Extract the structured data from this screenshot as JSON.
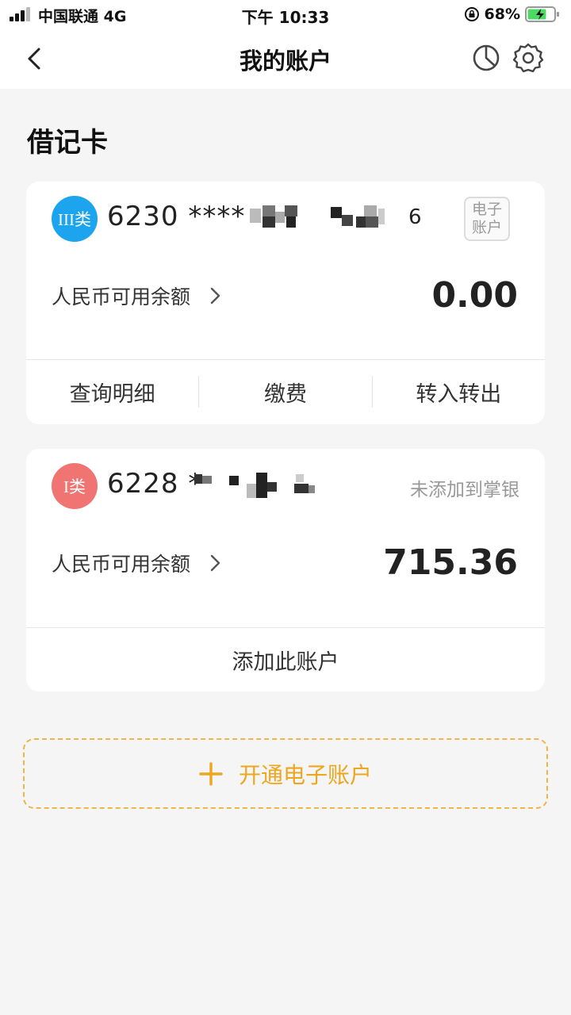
{
  "status_bar": {
    "carrier": "中国联通  4G",
    "time": "下午 10:33",
    "battery": "68%"
  },
  "nav": {
    "title": "我的账户",
    "icons": [
      "back-icon",
      "pie-chart-icon",
      "gear-icon"
    ]
  },
  "section": {
    "title": "借记卡"
  },
  "cards": [
    {
      "badge": "III类",
      "badge_color": "#1ca4ef",
      "number_visible": "6230 ****",
      "number_tail": "6",
      "tag": [
        "电子",
        "账户"
      ],
      "balance_label": "人民币可用余额",
      "balance": "0.00",
      "actions": [
        "查询明细",
        "缴费",
        "转入转出"
      ]
    },
    {
      "badge": "I类",
      "badge_color": "#f07572",
      "number_visible": "6228 *",
      "status": "未添加到掌银",
      "balance_label": "人民币可用余额",
      "balance": "715.36",
      "action": "添加此账户"
    }
  ],
  "open_account": {
    "label": "开通电子账户",
    "accent": "#eda61f"
  }
}
